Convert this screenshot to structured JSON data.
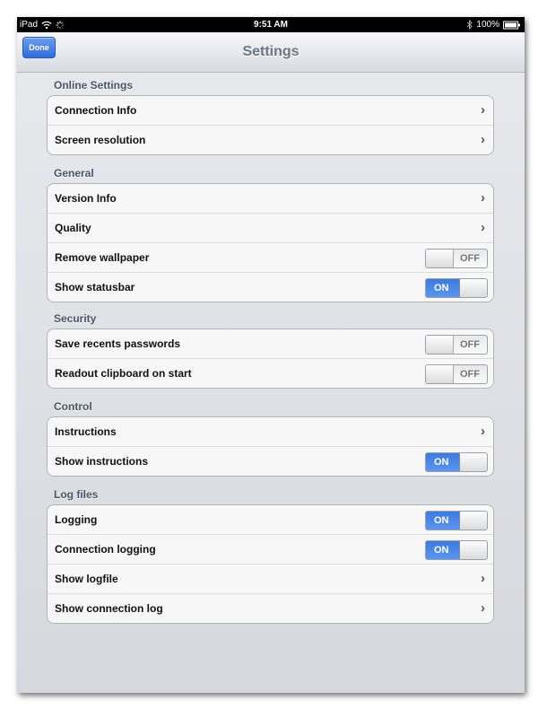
{
  "status_bar": {
    "device": "iPad",
    "time": "9:51 AM",
    "battery": "100%",
    "icons": [
      "wifi-icon",
      "activity-spinner-icon",
      "bluetooth-icon",
      "battery-icon"
    ]
  },
  "navbar": {
    "title": "Settings",
    "done_label": "Done"
  },
  "sections": {
    "online": {
      "header": "Online Settings",
      "rows": [
        {
          "label": "Connection Info",
          "control": "chevron"
        },
        {
          "label": "Screen resolution",
          "control": "chevron"
        }
      ]
    },
    "general": {
      "header": "General",
      "rows": [
        {
          "label": "Version Info",
          "control": "chevron"
        },
        {
          "label": "Quality",
          "control": "chevron"
        },
        {
          "label": "Remove wallpaper",
          "control": "toggle",
          "state": "OFF"
        },
        {
          "label": "Show statusbar",
          "control": "toggle",
          "state": "ON"
        }
      ]
    },
    "security": {
      "header": "Security",
      "rows": [
        {
          "label": "Save recents passwords",
          "control": "toggle",
          "state": "OFF"
        },
        {
          "label": "Readout clipboard on start",
          "control": "toggle",
          "state": "OFF"
        }
      ]
    },
    "control": {
      "header": "Control",
      "rows": [
        {
          "label": "Instructions",
          "control": "chevron"
        },
        {
          "label": "Show instructions",
          "control": "toggle",
          "state": "ON"
        }
      ]
    },
    "logfiles": {
      "header": "Log files",
      "rows": [
        {
          "label": "Logging",
          "control": "toggle",
          "state": "ON"
        },
        {
          "label": "Connection logging",
          "control": "toggle",
          "state": "ON"
        },
        {
          "label": "Show logfile",
          "control": "chevron"
        },
        {
          "label": "Show connection log",
          "control": "chevron"
        }
      ]
    }
  },
  "colors": {
    "accent": "#3c7ae0",
    "background": "#d9dbe0",
    "header_text": "#4b5563"
  }
}
